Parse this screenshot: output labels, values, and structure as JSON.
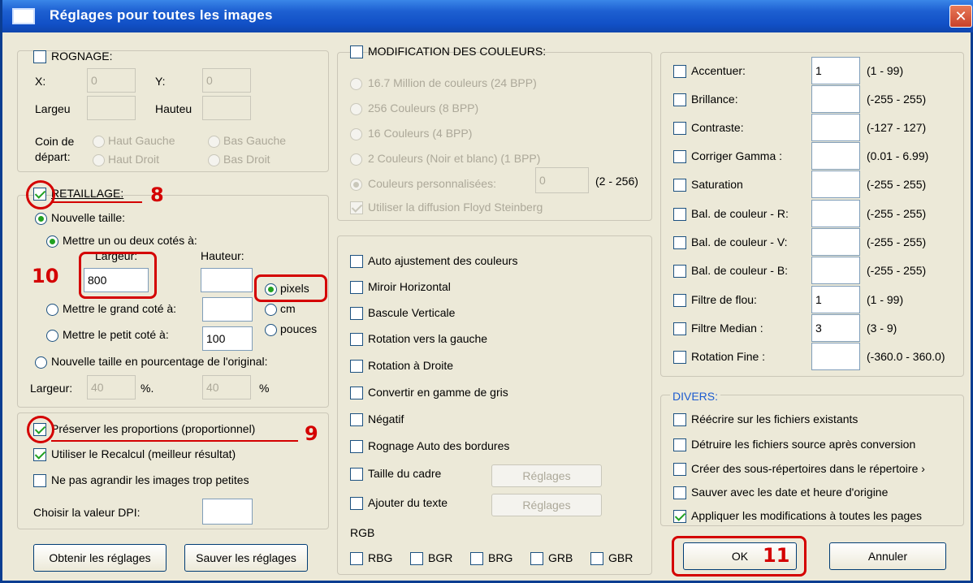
{
  "window": {
    "title": "Réglages pour toutes les images",
    "close_label": "✕"
  },
  "rognage": {
    "title": "ROGNAGE:",
    "x_label": "X:",
    "x_value": "0",
    "y_label": "Y:",
    "y_value": "0",
    "largeur_label": "Largeu",
    "hauteur_label": "Hauteu",
    "coin_label_1": "Coin de",
    "coin_label_2": "départ:",
    "haut_gauche": "Haut Gauche",
    "bas_gauche": "Bas Gauche",
    "haut_droit": "Haut Droit",
    "bas_droit": "Bas Droit"
  },
  "retaillage": {
    "title": "RETAILLAGE:",
    "nouvelle_taille": "Nouvelle taille:",
    "mettre_un_ou_deux": "Mettre un ou deux cotés à:",
    "largeur_label": "Largeur:",
    "largeur_value": "800",
    "hauteur_label": "Hauteur:",
    "hauteur_value": "",
    "pixels": "pixels",
    "cm": "cm",
    "pouces": "pouces",
    "grand_cote": "Mettre le grand coté à:",
    "grand_cote_value": "",
    "petit_cote": "Mettre le petit coté à:",
    "petit_cote_value": "100",
    "pourcentage": "Nouvelle taille en pourcentage de l'original:",
    "pct_largeur_label": "Largeur:",
    "pct_largeur_value": "40",
    "pct_sign": "%.",
    "pct_hauteur_value": "40",
    "pct_sign2": "%"
  },
  "options": {
    "preserver": "Préserver les proportions (proportionnel)",
    "recalcul": "Utiliser le Recalcul (meilleur résultat)",
    "ne_pas_agrandir": "Ne pas agrandir les images trop petites",
    "dpi_label": "Choisir la valeur DPI:",
    "dpi_value": ""
  },
  "couleurs": {
    "title": "MODIFICATION DES COULEURS:",
    "options": [
      "16.7 Million de couleurs (24 BPP)",
      "256 Couleurs (8 BPP)",
      "16 Couleurs (4 BPP)",
      "2 Couleurs (Noir et blanc) (1 BPP)",
      "Couleurs personnalisées:"
    ],
    "custom_value": "0",
    "custom_range": "(2 - 256)",
    "floyd": "Utiliser la diffusion Floyd Steinberg"
  },
  "transforms": {
    "items": [
      "Auto ajustement des couleurs",
      "Miroir Horizontal",
      "Bascule Verticale",
      "Rotation vers la gauche",
      "Rotation à Droite",
      "Convertir en gamme de gris",
      "Négatif",
      "Rognage Auto des bordures",
      "Taille du cadre",
      "Ajouter du texte"
    ],
    "reglages_label": "Réglages",
    "rgb_label": "RGB",
    "rgb_options": [
      "RBG",
      "BGR",
      "BRG",
      "GRB",
      "GBR"
    ]
  },
  "adjust": {
    "items": [
      {
        "label": "Accentuer:",
        "value": "1",
        "range": "(1  -  99)"
      },
      {
        "label": "Brillance:",
        "value": "",
        "range": "(-255  -  255)"
      },
      {
        "label": "Contraste:",
        "value": "",
        "range": "(-127  -  127)"
      },
      {
        "label": "Corriger Gamma :",
        "value": "",
        "range": "(0.01  -  6.99)"
      },
      {
        "label": "Saturation",
        "value": "",
        "range": "(-255  -  255)"
      },
      {
        "label": "Bal. de couleur - R:",
        "value": "",
        "range": "(-255  -  255)"
      },
      {
        "label": "Bal. de couleur - V:",
        "value": "",
        "range": "(-255  -  255)"
      },
      {
        "label": "Bal. de couleur - B:",
        "value": "",
        "range": "(-255  -  255)"
      },
      {
        "label": "Filtre de flou:",
        "value": "1",
        "range": "(1  -  99)"
      },
      {
        "label": "Filtre Median :",
        "value": "3",
        "range": "(3  -  9)"
      },
      {
        "label": "Rotation Fine :",
        "value": "",
        "range": "(-360.0  -  360.0)"
      }
    ]
  },
  "divers": {
    "title": "DIVERS:",
    "items": [
      {
        "label": "Réécrire sur les fichiers existants",
        "checked": false
      },
      {
        "label": "Détruire les fichiers source après conversion",
        "checked": false
      },
      {
        "label": "Créer des sous-répertoires dans le répertoire ›",
        "checked": false
      },
      {
        "label": "Sauver  avec les date et heure d'origine",
        "checked": false
      },
      {
        "label": "Appliquer les modifications à toutes les pages",
        "checked": true
      }
    ]
  },
  "buttons": {
    "obtenir": "Obtenir les réglages",
    "sauver": "Sauver les réglages",
    "ok": "OK",
    "annuler": "Annuler"
  },
  "annotations": {
    "n8": "8",
    "n9": "9",
    "n10": "10",
    "n11": "11"
  },
  "colors": {
    "annotation": "#d40000",
    "title_bar": "#1150c6",
    "check": "#21a121"
  }
}
